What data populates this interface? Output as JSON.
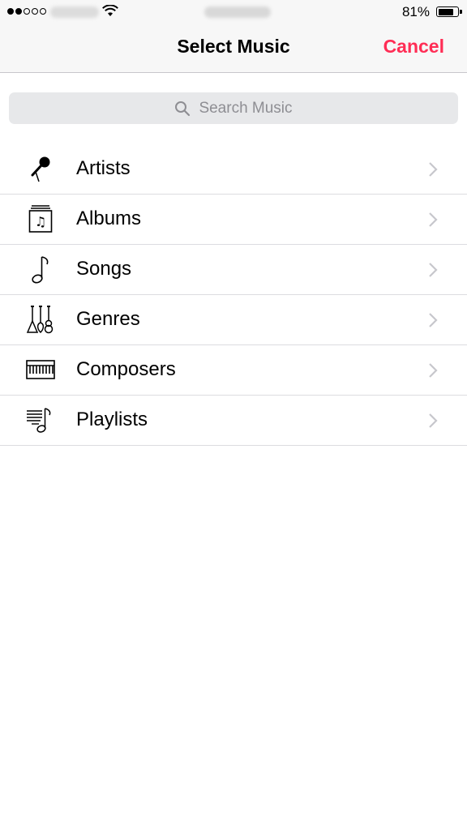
{
  "status_bar": {
    "battery_percent_label": "81%",
    "battery_level": 0.81
  },
  "nav": {
    "title": "Select Music",
    "cancel_label": "Cancel",
    "accent_color": "#ff2d55"
  },
  "search": {
    "placeholder": "Search Music",
    "icon": "search-icon"
  },
  "list": {
    "items": [
      {
        "label": "Artists",
        "icon": "microphone-icon"
      },
      {
        "label": "Albums",
        "icon": "album-icon"
      },
      {
        "label": "Songs",
        "icon": "music-note-icon"
      },
      {
        "label": "Genres",
        "icon": "guitars-icon"
      },
      {
        "label": "Composers",
        "icon": "piano-keyboard-icon"
      },
      {
        "label": "Playlists",
        "icon": "playlist-icon"
      }
    ]
  }
}
